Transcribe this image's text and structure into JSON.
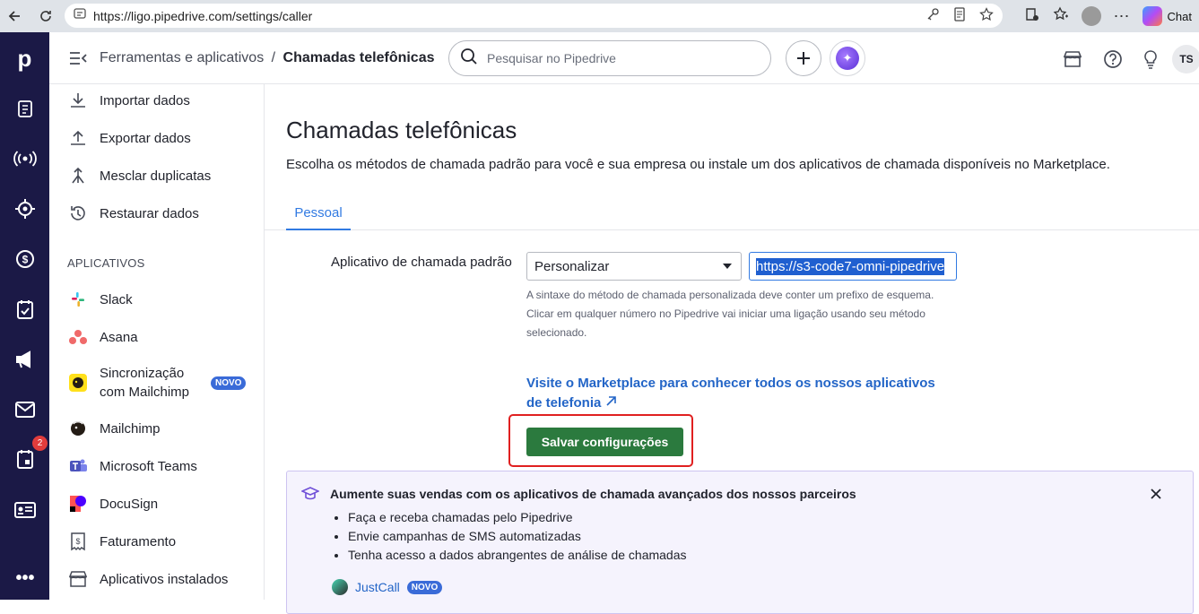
{
  "browser": {
    "url": "https://ligo.pipedrive.com/settings/caller",
    "chat_label": "Chat"
  },
  "rail": {
    "logo": "p",
    "badge_count": "2"
  },
  "header": {
    "breadcrumb_parent": "Ferramentas e aplicativos",
    "breadcrumb_sep": "/",
    "breadcrumb_current": "Chamadas telefônicas",
    "search_placeholder": "Pesquisar no Pipedrive",
    "avatar_initials": "TS"
  },
  "sidebar": {
    "items": [
      {
        "label": "Importar dados",
        "icon": "download-icon"
      },
      {
        "label": "Exportar dados",
        "icon": "upload-icon"
      },
      {
        "label": "Mesclar duplicatas",
        "icon": "merge-icon"
      },
      {
        "label": "Restaurar dados",
        "icon": "restore-icon"
      }
    ],
    "apps_heading": "APLICATIVOS",
    "apps": [
      {
        "label": "Slack",
        "icon": "slack-icon"
      },
      {
        "label": "Asana",
        "icon": "asana-icon"
      },
      {
        "label": "Sincronização com Mailchimp",
        "icon": "mailchimp-icon",
        "badge": "NOVO"
      },
      {
        "label": "Mailchimp",
        "icon": "mailchimp-icon"
      },
      {
        "label": "Microsoft Teams",
        "icon": "teams-icon"
      },
      {
        "label": "DocuSign",
        "icon": "docusign-icon"
      },
      {
        "label": "Faturamento",
        "icon": "billing-icon"
      },
      {
        "label": "Aplicativos instalados",
        "icon": "store-icon"
      }
    ]
  },
  "main": {
    "title": "Chamadas telefônicas",
    "description": "Escolha os métodos de chamada padrão para você e sua empresa ou instale um dos aplicativos de chamada disponíveis no Marketplace.",
    "tab": "Pessoal",
    "field_label": "Aplicativo de chamada padrão",
    "select_value": "Personalizar",
    "url_value": "https://s3-code7-omni-pipedrive",
    "help_line1": "A sintaxe do método de chamada personalizada deve conter um prefixo de esquema.",
    "help_line2": "Clicar em qualquer número no Pipedrive vai iniciar uma ligação usando seu método selecionado.",
    "marketplace_link": "Visite o Marketplace para conhecer todos os nossos aplicativos de telefonia",
    "save_label": "Salvar configurações"
  },
  "promo": {
    "heading": "Aumente suas vendas com os aplicativos de chamada avançados dos nossos parceiros",
    "bullets": [
      "Faça e receba chamadas pelo Pipedrive",
      "Envie campanhas de SMS automatizadas",
      "Tenha acesso a dados abrangentes de análise de chamadas"
    ],
    "partner": "JustCall",
    "partner_badge": "NOVO"
  }
}
